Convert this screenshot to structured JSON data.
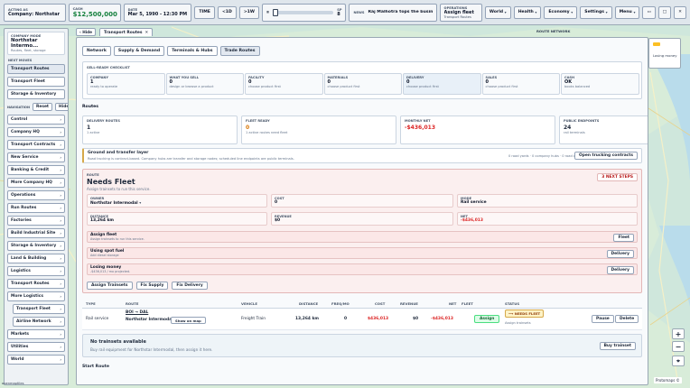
{
  "topbar": {
    "acting_label": "ACTING AS",
    "acting_value": "Company: Northstar Intermodal",
    "cash_label": "CASH",
    "cash_value": "$12,500,000",
    "date_label": "DATE",
    "date_value": "Mar 5, 1990 - 12:30 PM",
    "time_label": "TIME",
    "btn_back": "<1D",
    "btn_fwd": ">1W",
    "speed_label": "SP",
    "speed_value": "8",
    "speed_fraction": 0.03,
    "news_label": "NEWS",
    "news_value": "Raj Malhotra tops the business rankings",
    "ops_label": "OPERATIONS",
    "ops_value": "Assign fleet",
    "ops_sub": "Transport Routes",
    "menus": [
      "World",
      "Health",
      "Economy",
      "Settings",
      "Menu"
    ],
    "win_buttons": [
      "▭",
      "□",
      "✕"
    ]
  },
  "sidebar": {
    "company_label": "COMPANY MODE",
    "company_name": "Northstar Intermo...",
    "company_sub": "Routes, fleet, storage",
    "next_moves_label": "NEXT MOVES",
    "next_moves": [
      "Transport Routes",
      "Transport Fleet",
      "Storage & Inventory"
    ],
    "nav_label": "NAVIGATION",
    "reset_label": "Reset",
    "hide_label": "Hide",
    "nav_items": [
      {
        "label": "Control",
        "sub": false
      },
      {
        "label": "Company HQ",
        "sub": false
      },
      {
        "label": "Transport Contracts",
        "sub": false
      },
      {
        "label": "New Service",
        "sub": false
      },
      {
        "label": "Banking & Credit",
        "sub": false
      },
      {
        "label": "More Company HQ",
        "sub": false
      },
      {
        "label": "Operations",
        "sub": false
      },
      {
        "label": "Run Routes",
        "sub": false
      },
      {
        "label": "Factories",
        "sub": false
      },
      {
        "label": "Build Industrial Site",
        "sub": false
      },
      {
        "label": "Storage & Inventory",
        "sub": false
      },
      {
        "label": "Land & Building",
        "sub": false
      },
      {
        "label": "Logistics",
        "sub": false
      },
      {
        "label": "Transport Routes",
        "sub": false
      },
      {
        "label": "More Logistics",
        "sub": false
      },
      {
        "label": "Transport Fleet",
        "sub": true
      },
      {
        "label": "Airline Network",
        "sub": true
      },
      {
        "label": "Markets",
        "sub": false
      },
      {
        "label": "Utilities",
        "sub": false
      },
      {
        "label": "World",
        "sub": false
      }
    ]
  },
  "header": {
    "hide_label": "Hide",
    "tab_label": "Transport Routes",
    "route_network_label": "ROUTE NETWORK"
  },
  "subtabs": [
    "Network",
    "Supply & Demand",
    "Terminals & Hubs",
    "Trade Routes"
  ],
  "checklist": {
    "title": "SELL-READY CHECKLIST",
    "cells": [
      {
        "cap": "COMPANY",
        "val": "1",
        "note": "ready to operate"
      },
      {
        "cap": "WHAT YOU SELL",
        "val": "0",
        "note": "design or browse a product"
      },
      {
        "cap": "FACILITY",
        "val": "0",
        "note": "choose product first"
      },
      {
        "cap": "MATERIALS",
        "val": "0",
        "note": "choose product first"
      },
      {
        "cap": "DELIVERY",
        "val": "0",
        "note": "choose product first"
      },
      {
        "cap": "SALES",
        "val": "0",
        "note": "choose product first"
      },
      {
        "cap": "CASH",
        "val": "OK",
        "note": "books balanced"
      }
    ]
  },
  "routes_title": "Routes",
  "stats": [
    {
      "cap": "DELIVERY ROUTES",
      "val": "1",
      "note": "1 active",
      "tone": ""
    },
    {
      "cap": "FLEET READY",
      "val": "0",
      "note": "1 active routes need fleet",
      "tone": "amber"
    },
    {
      "cap": "MONTHLY NET",
      "val": "-$436,013",
      "note": "",
      "tone": "red"
    },
    {
      "cap": "PUBLIC ENDPOINTS",
      "val": "24",
      "note": "rail terminals",
      "tone": ""
    }
  ],
  "ground": {
    "title": "Ground and transfer layer",
    "desc": "Road trucking is contract-based. Company hubs are transfer and storage nodes; scheduled line endpoints are public terminals.",
    "meta": "0 road yards · 0 company hubs · 0 road offers",
    "button": "Open trucking contracts"
  },
  "fleet": {
    "route_label": "ROUTE",
    "title": "Needs Fleet",
    "subtitle": "Assign trainsets to run this service.",
    "next_steps": "3 NEXT STEPS",
    "owner_label": "OWNER",
    "owner_value": "Northstar Intermodal",
    "cost_label": "COST",
    "cost_value": "0",
    "mode_label": "MODE",
    "mode_value": "Rail service",
    "distance_label": "DISTANCE",
    "distance_value": "13,264 km",
    "revenue_label": "REVENUE",
    "revenue_value": "$0",
    "net_label": "NET",
    "net_value": "-$436,013",
    "warnings": [
      {
        "title": "Assign fleet",
        "note": "Assign trainsets to run this service.",
        "button": "Fleet"
      },
      {
        "title": "Using spot fuel",
        "note": "Add diesel storage",
        "button": "Delivery"
      },
      {
        "title": "Losing money",
        "note": "-$436,013 / mo projected.",
        "button": "Delivery"
      }
    ],
    "actions": [
      "Assign Trainsets",
      "Fix Supply",
      "Fix Delivery"
    ]
  },
  "table": {
    "headers": [
      "TYPE",
      "ROUTE",
      "VEHICLE",
      "DISTANCE",
      "FREQ/MO",
      "COST",
      "REVENUE",
      "NET",
      "FLEET",
      "STATUS"
    ],
    "row": {
      "type": "Rail service",
      "route_code": "BOI → DAL",
      "route_owner": "Northstar Intermodal",
      "show_map": "Show on map",
      "vehicle": "Freight Train",
      "distance": "13,264 km",
      "freq": "0",
      "cost": "$436,013",
      "revenue": "$0",
      "net": "-$436,013",
      "assign": "Assign",
      "status": "NEEDS FLEET",
      "status_note": "Assign trainsets",
      "pause": "Pause",
      "delete": "Delete"
    },
    "empty_title": "No trainsets available",
    "empty_desc": "Buy rail equipment for Northstar Intermodal, then assign it here.",
    "buy_button": "Buy trainset",
    "start_route": "Start Route"
  },
  "right": {
    "legend_value": "Losing money"
  },
  "map": {
    "zoom_in": "+",
    "zoom_out": "−",
    "compass": "⌖",
    "attribution": "Protomaps ©",
    "corner": "openmaptiles"
  },
  "colors": {
    "cash": "#15803d",
    "negative": "#dc2626",
    "warning_bg": "#fbefef",
    "assign": "#dcfce7"
  }
}
